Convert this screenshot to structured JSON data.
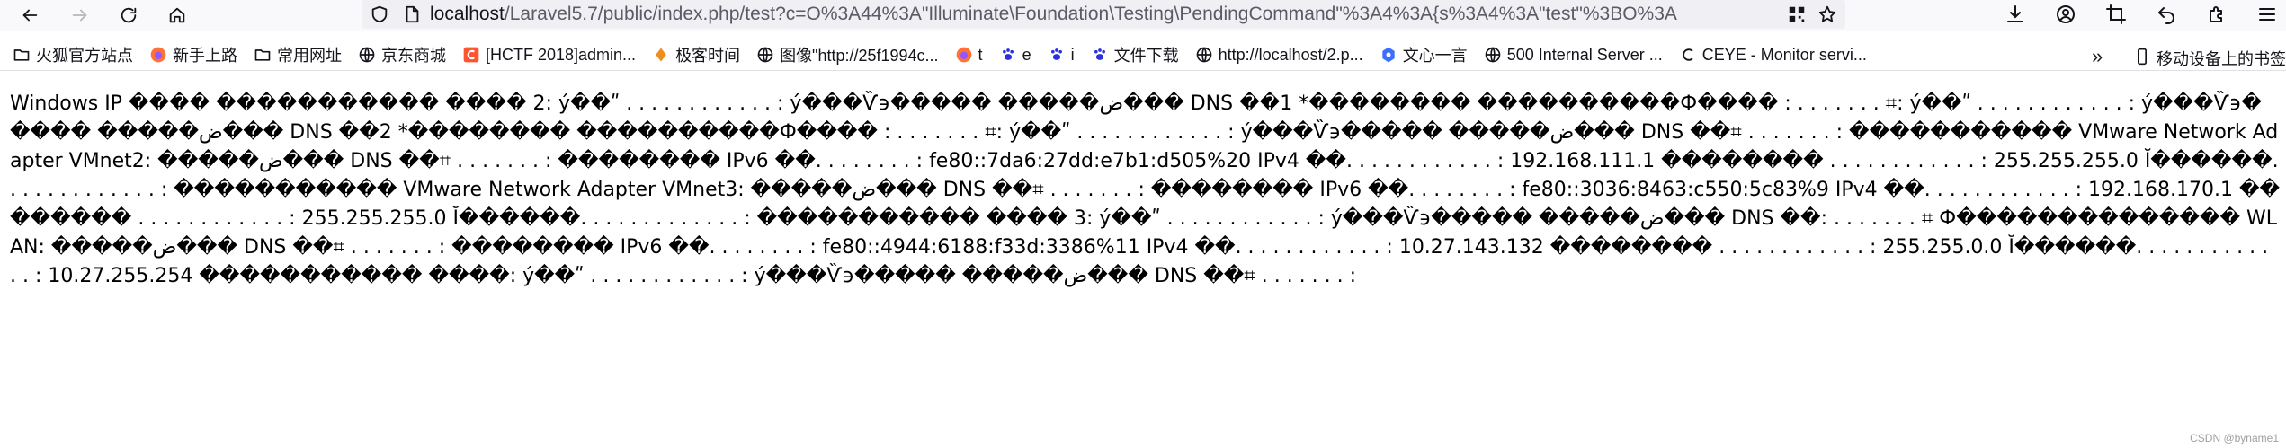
{
  "browser": {
    "url_host": "localhost",
    "url_rest": "/Laravel5.7/public/index.php/test?c=O%3A44%3A\"Illuminate\\Foundation\\Testing\\PendingCommand\"%3A4%3A{s%3A4%3A\"test\"%3BO%3A",
    "icons": {
      "back": "arrow-left-icon",
      "forward": "arrow-right-icon",
      "reload": "reload-icon",
      "home": "home-icon",
      "tracking": "shield-icon",
      "page": "page-icon",
      "qr": "qr-code-icon",
      "bookmark_star": "star-icon",
      "downloads": "download-icon",
      "account": "account-icon",
      "screenshot": "crop-icon",
      "undo": "undo-icon",
      "extensions": "extensions-icon",
      "menu": "menu-icon"
    }
  },
  "bookmarks": {
    "items": [
      {
        "label": "火狐官方站点",
        "icon": "folder-icon"
      },
      {
        "label": "新手上路",
        "icon": "firefox-icon"
      },
      {
        "label": "常用网址",
        "icon": "folder-icon"
      },
      {
        "label": "京东商城",
        "icon": "globe-icon"
      },
      {
        "label": "[HCTF 2018]admin...",
        "icon": "c-logo-icon"
      },
      {
        "label": "极客时间",
        "icon": "geek-icon"
      },
      {
        "label": "图像\"http://25f1994c...",
        "icon": "globe-icon"
      },
      {
        "label": "t",
        "icon": "firefox-icon"
      },
      {
        "label": "e",
        "icon": "paw-icon"
      },
      {
        "label": "i",
        "icon": "paw-icon"
      },
      {
        "label": "文件下载",
        "icon": "paw-icon"
      },
      {
        "label": "http://localhost/2.p...",
        "icon": "globe-icon"
      },
      {
        "label": "文心一言",
        "icon": "wenxin-icon"
      },
      {
        "label": "500 Internal Server ...",
        "icon": "globe-icon"
      },
      {
        "label": "CEYE - Monitor servi...",
        "icon": "ceye-icon"
      }
    ],
    "more": "»",
    "mobile": "移动设备上的书签"
  },
  "page": {
    "output": "Windows IP ���� ����������� ���� 2: ý��ʺ . . . . . . . . . . . . : ý���Ѷ϶����� �����ض��� DNS ��1 *�������� ����������Ф���� : . . . . . . . ⌗: ý��ʺ . . . . . . . . . . . . : ý���Ѷ϶����� �����ض��� DNS ��2 *�������� ����������Ф���� : . . . . . . . ⌗: ý��ʺ . . . . . . . . . . . . : ý���Ѷ϶����� �����ض��� DNS ��⌗ . . . . . . . : ����������� VMware Network Adapter VMnet2: �����ض��� DNS ��⌗ . . . . . . . : �������� IPv6 ��. . . . . . . . : fe80::7da6:27dd:e7b1:d505%20 IPv4 ��. . . . . . . . . . . . : 192.168.111.1 �������� . . . . . . . . . . . . : 255.255.255.0 Ĭ������. . . . . . . . . . . . . : ����������� VMware Network Adapter VMnet3: �����ض��� DNS ��⌗ . . . . . . . : �������� IPv6 ��. . . . . . . . : fe80::3036:8463:c550:5c83%9 IPv4 ��. . . . . . . . . . . . : 192.168.170.1 �������� . . . . . . . . . . . . : 255.255.255.0 Ĭ������. . . . . . . . . . . . . : ����������� ���� 3: ý��ʺ . . . . . . . . . . . . : ý���Ѷ϶����� �����ض��� DNS ��: . . . . . . . ⌗ Ф�������������� WLAN: �����ض��� DNS ��⌗ . . . . . . . : �������� IPv6 ��. . . . . . . . : fe80::4944:6188:f33d:3386%11 IPv4 ��. . . . . . . . . . . . : 10.27.143.132 �������� . . . . . . . . . . . . : 255.255.0.0 Ĭ������. . . . . . . . . . . . . : 10.27.255.254 ����������� ����: ý��ʺ . . . . . . . . . . . . : ý���Ѷ϶����� �����ض��� DNS ��⌗ . . . . . . . :"
  },
  "watermark": "CSDN @byname1"
}
